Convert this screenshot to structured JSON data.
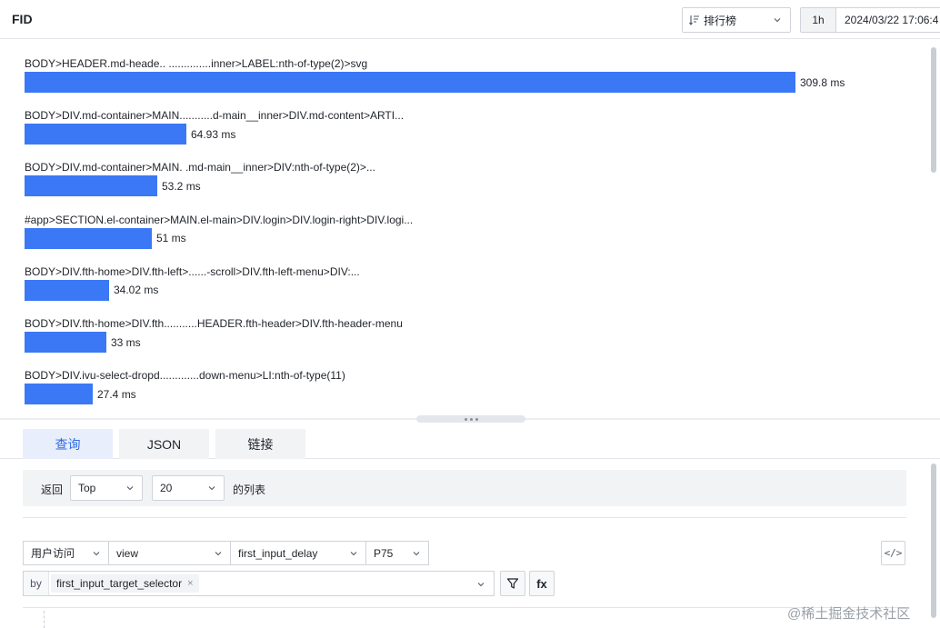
{
  "header": {
    "title": "FID",
    "sort_label": "排行榜",
    "range_label": "1h",
    "date_value": "2024/03/22 17:06:4"
  },
  "chart_data": {
    "type": "bar",
    "orientation": "horizontal",
    "unit": "ms",
    "categories": [
      "BODY>HEADER.md-heade.. ..............inner>LABEL:nth-of-type(2)>svg",
      "BODY>DIV.md-container>MAIN...........d-main__inner>DIV.md-content>ARTI...",
      "BODY>DIV.md-container>MAIN.            .md-main__inner>DIV:nth-of-type(2)>...",
      "#app>SECTION.el-container>MAIN.el-main>DIV.login>DIV.login-right>DIV.logi...",
      "BODY>DIV.fth-home>DIV.fth-left>......-scroll>DIV.fth-left-menu>DIV:...",
      "BODY>DIV.fth-home>DIV.fth...........HEADER.fth-header>DIV.fth-header-menu",
      "BODY>DIV.ivu-select-dropd.............down-menu>LI:nth-of-type(11)"
    ],
    "values": [
      309.8,
      64.93,
      53.2,
      51,
      34.02,
      33,
      27.4
    ],
    "value_labels": [
      "309.8 ms",
      "64.93 ms",
      "53.2 ms",
      "51 ms",
      "34.02 ms",
      "33 ms",
      "27.4 ms"
    ],
    "bar_color": "#3b78f5"
  },
  "tabs": [
    {
      "label": "查询"
    },
    {
      "label": "JSON"
    },
    {
      "label": "链接"
    }
  ],
  "query": {
    "return_label": "返回",
    "order_value": "Top",
    "limit_value": "20",
    "list_label": "的列表",
    "category_value": "用户访问",
    "event_value": "view",
    "metric_value": "first_input_delay",
    "agg_value": "P75",
    "by_label": "by",
    "group_tag": "first_input_target_selector",
    "tag_close": "×",
    "code_icon_text": "</>",
    "fx_label": "fx"
  },
  "watermark": "@稀土掘金技术社区",
  "colors": {
    "accent": "#2f6ae3",
    "bar": "#3b78f5",
    "active_tab_bg": "#e8eefc"
  }
}
